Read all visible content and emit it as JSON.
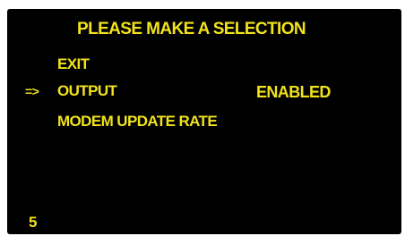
{
  "screen": {
    "title": "PLEASE MAKE A SELECTION",
    "cursor": "=>",
    "items": [
      {
        "label": "EXIT",
        "value": ""
      },
      {
        "label": "OUTPUT",
        "value": "ENABLED"
      },
      {
        "label": "MODEM UPDATE RATE",
        "value": ""
      }
    ],
    "footer_number": "5"
  },
  "colors": {
    "background": "#000000",
    "text": "#f2e21c"
  }
}
